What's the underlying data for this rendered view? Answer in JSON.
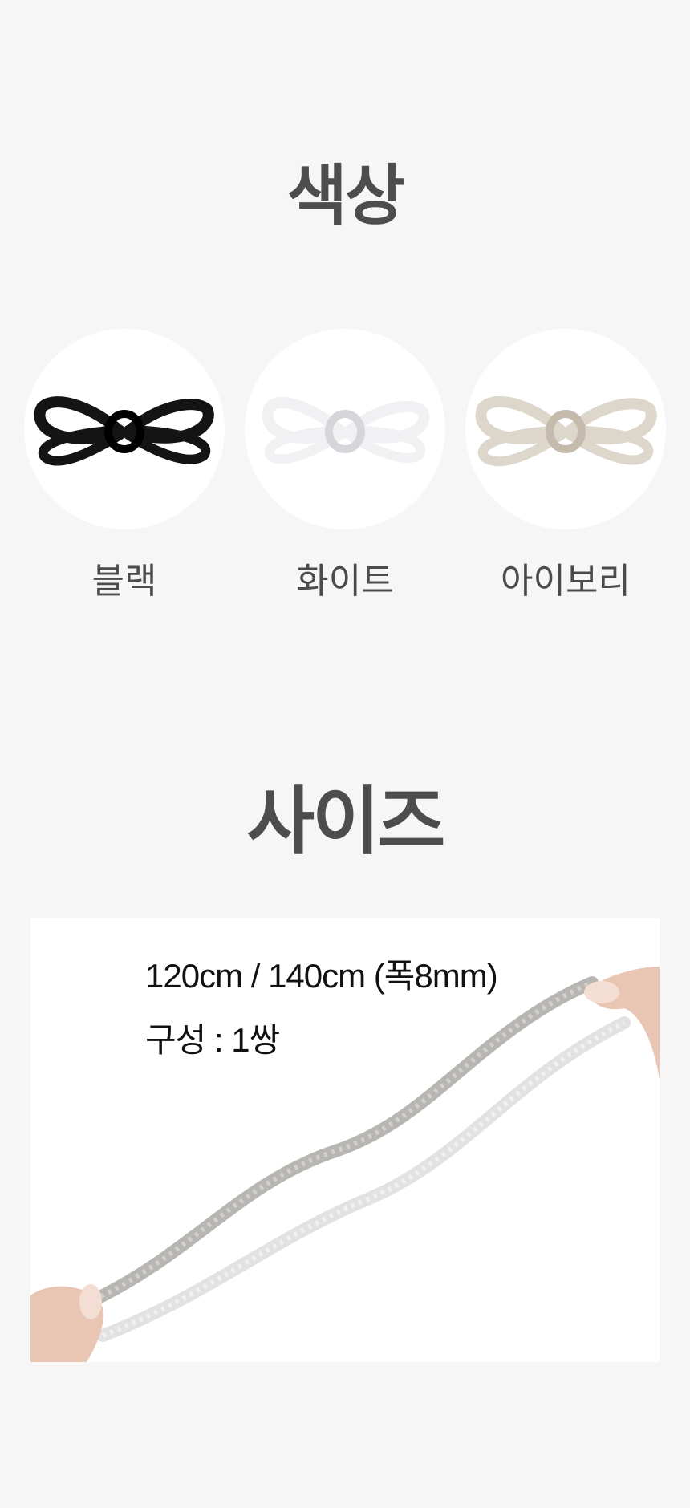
{
  "color_section": {
    "title": "색상",
    "swatches": [
      {
        "label": "블랙",
        "color": "#141414",
        "shade": "#000000"
      },
      {
        "label": "화이트",
        "color": "#f1f1f3",
        "shade": "#d6d6da"
      },
      {
        "label": "아이보리",
        "color": "#ddd6cb",
        "shade": "#c4bbad"
      }
    ]
  },
  "size_section": {
    "title": "사이즈",
    "spec_line1": "120cm / 140cm (폭8mm)",
    "spec_line2": "구성 : 1쌍"
  }
}
